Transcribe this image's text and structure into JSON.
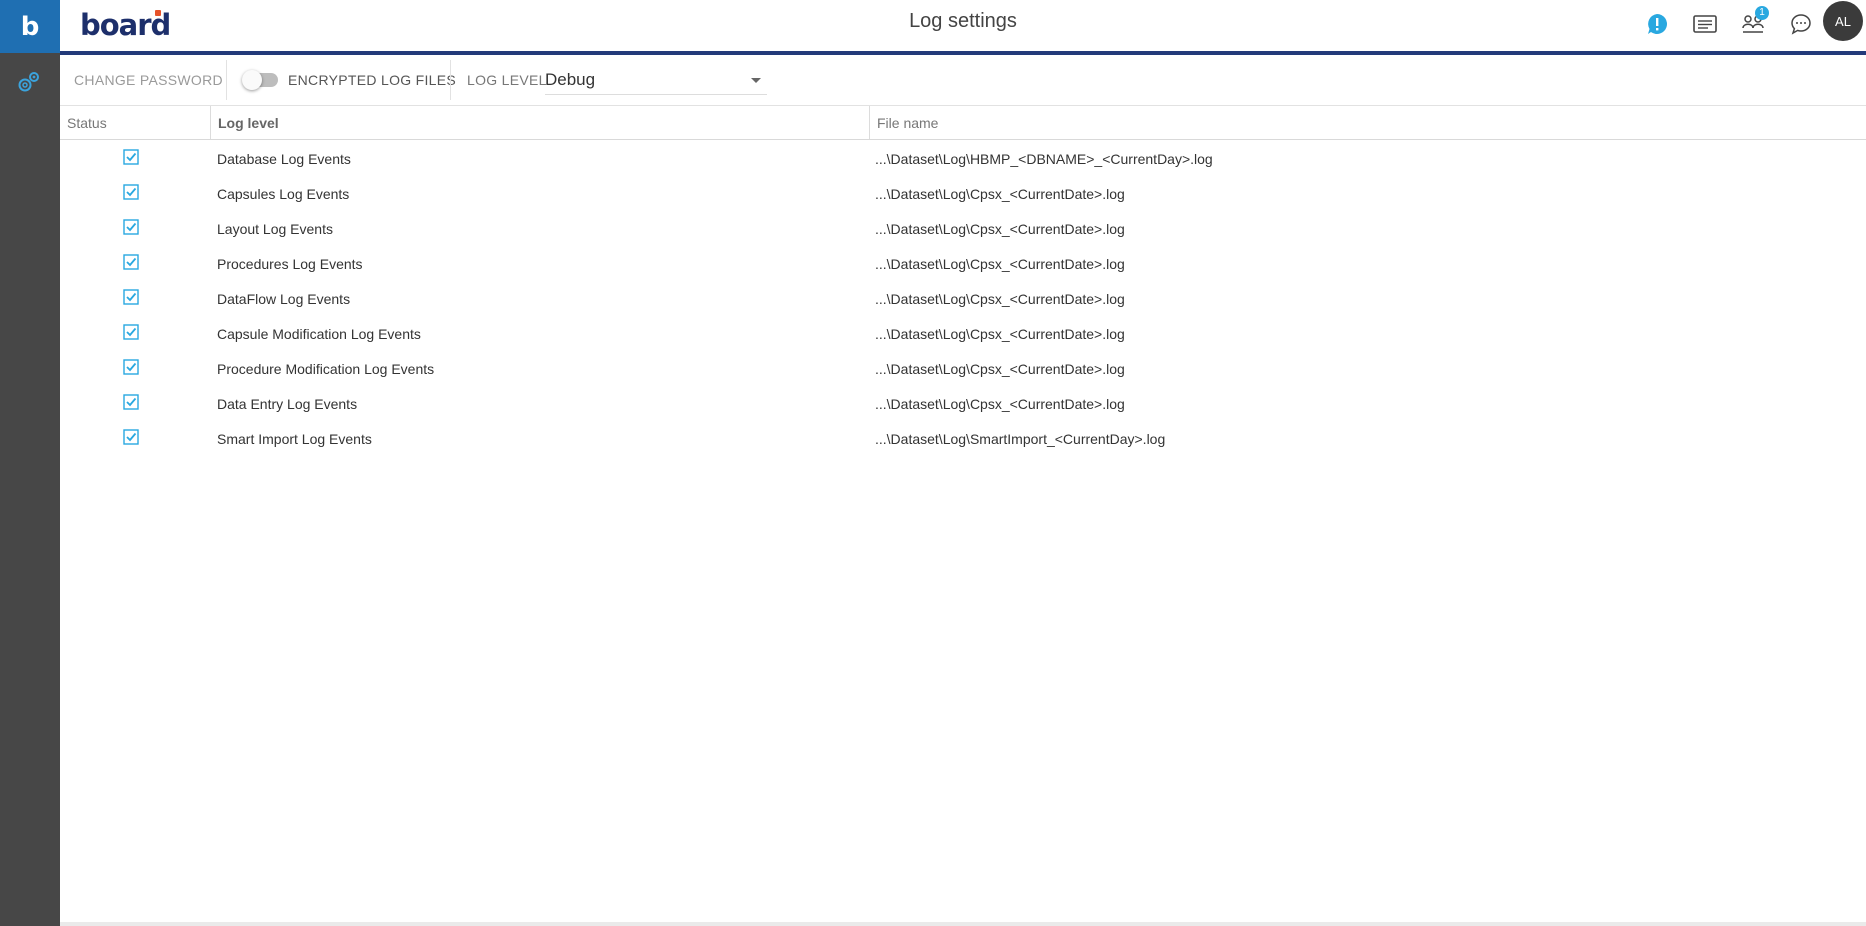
{
  "rail": {
    "brand_letter": "b"
  },
  "header": {
    "logo_text": "board",
    "title": "Log settings",
    "notifications_badge": "1",
    "avatar_initials": "AL"
  },
  "toolbar": {
    "change_password_label": "CHANGE PASSWORD",
    "encrypted_label": "ENCRYPTED LOG FILES",
    "log_level_label": "LOG LEVEL",
    "log_level_value": "Debug"
  },
  "table": {
    "columns": [
      "Status",
      "Log level",
      "File name"
    ],
    "rows": [
      {
        "checked": true,
        "level": "Database Log Events",
        "file": "...\\Dataset\\Log\\HBMP_<DBNAME>_<CurrentDay>.log"
      },
      {
        "checked": true,
        "level": "Capsules Log Events",
        "file": "...\\Dataset\\Log\\Cpsx_<CurrentDate>.log"
      },
      {
        "checked": true,
        "level": "Layout Log Events",
        "file": "...\\Dataset\\Log\\Cpsx_<CurrentDate>.log"
      },
      {
        "checked": true,
        "level": "Procedures Log Events",
        "file": "...\\Dataset\\Log\\Cpsx_<CurrentDate>.log"
      },
      {
        "checked": true,
        "level": "DataFlow Log Events",
        "file": "...\\Dataset\\Log\\Cpsx_<CurrentDate>.log"
      },
      {
        "checked": true,
        "level": "Capsule Modification Log Events",
        "file": "...\\Dataset\\Log\\Cpsx_<CurrentDate>.log"
      },
      {
        "checked": true,
        "level": "Procedure Modification Log Events",
        "file": "...\\Dataset\\Log\\Cpsx_<CurrentDate>.log"
      },
      {
        "checked": true,
        "level": "Data Entry Log Events",
        "file": "...\\Dataset\\Log\\Cpsx_<CurrentDate>.log"
      },
      {
        "checked": true,
        "level": "Smart Import Log Events",
        "file": "...\\Dataset\\Log\\SmartImport_<CurrentDay>.log"
      }
    ]
  },
  "colors": {
    "accent": "#29a8e0",
    "header_rule": "#233a7a",
    "rail": "#474747",
    "brand": "#1f6fb2"
  },
  "icons": {
    "rail": [
      "gears-icon"
    ],
    "header": [
      "alert-icon",
      "list-card-icon",
      "users-icon",
      "chat-icon"
    ]
  }
}
